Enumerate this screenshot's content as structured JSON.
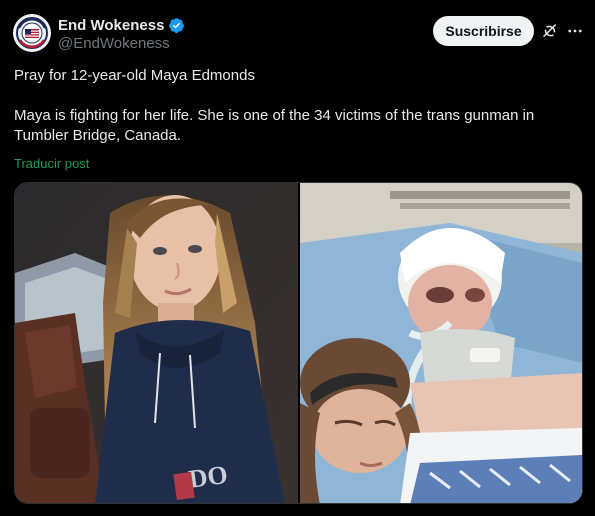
{
  "author": {
    "display_name": "End Wokeness",
    "handle": "@EndWokeness",
    "verified": true,
    "avatar_icon": "account-avatar-seal"
  },
  "actions": {
    "subscribe_label": "Suscribirse",
    "grok_icon": "grok-icon",
    "more_icon": "more-icon"
  },
  "tweet": {
    "line1": "Pray for 12-year-old Maya Edmonds",
    "line2": "Maya is fighting for her life. She is one of the 34 victims of the trans gunman in Tumbler Bridge, Canada.",
    "translate_label": "Traducir post"
  },
  "colors": {
    "background": "#000000",
    "text": "#e7e9ea",
    "secondary": "#71767b",
    "verified": "#1d9bf0",
    "translate_link": "#1d9b50"
  }
}
